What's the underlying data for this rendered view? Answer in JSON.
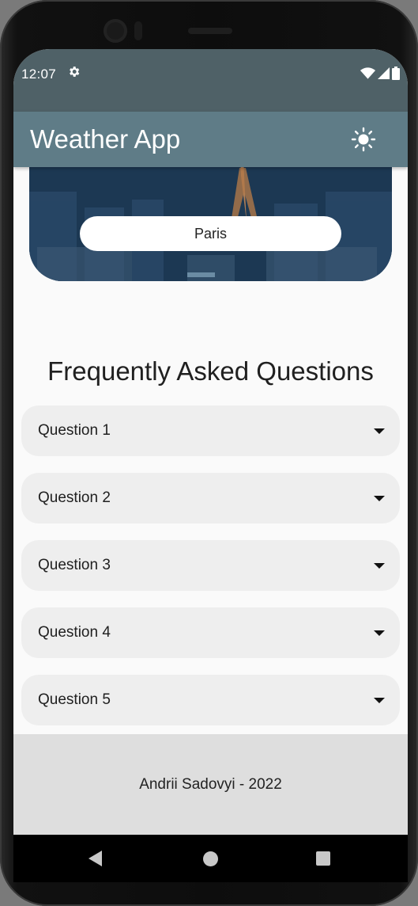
{
  "status_bar": {
    "time": "12:07",
    "settings_icon": "gear-icon",
    "wifi_icon": "wifi-icon",
    "signal_icon": "signal-icon",
    "battery_icon": "battery-icon"
  },
  "app_bar": {
    "title": "Weather App",
    "theme_toggle_icon": "sun-icon"
  },
  "hero": {
    "city_value": "Paris"
  },
  "faq": {
    "title": "Frequently Asked Questions",
    "items": [
      {
        "label": "Question 1"
      },
      {
        "label": "Question 2"
      },
      {
        "label": "Question 3"
      },
      {
        "label": "Question 4"
      },
      {
        "label": "Question 5"
      }
    ]
  },
  "footer": {
    "text": "Andrii Sadovyi - 2022"
  },
  "nav_bar": {
    "back_icon": "back-icon",
    "home_icon": "home-icon",
    "recents_icon": "recents-icon"
  },
  "colors": {
    "status_bar": "#4f6167",
    "app_bar": "#5f7c87",
    "faq_item_bg": "#eeeeee",
    "footer_bg": "#dedede"
  }
}
